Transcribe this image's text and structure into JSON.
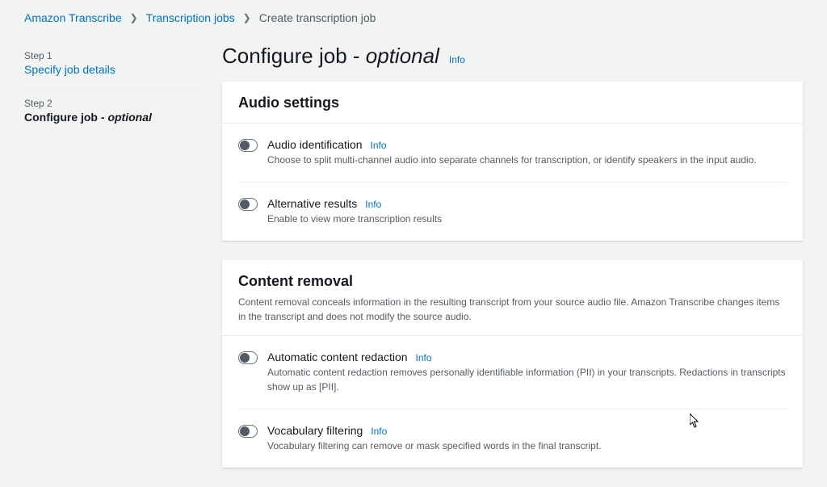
{
  "breadcrumb": {
    "item1": "Amazon Transcribe",
    "item2": "Transcription jobs",
    "current": "Create transcription job"
  },
  "sidebar": {
    "step1_label": "Step 1",
    "step1_link": "Specify job details",
    "step2_label": "Step 2",
    "step2_text_pre": "Configure job - ",
    "step2_text_em": "optional"
  },
  "page": {
    "title_pre": "Configure job ",
    "title_sep": "- ",
    "title_em": "optional",
    "info": "Info"
  },
  "audio": {
    "heading": "Audio settings",
    "item1_title": "Audio identification",
    "item1_info": "Info",
    "item1_desc": "Choose to split multi-channel audio into separate channels for transcription, or identify speakers in the input audio.",
    "item2_title": "Alternative results",
    "item2_info": "Info",
    "item2_desc": "Enable to view more transcription results"
  },
  "content": {
    "heading": "Content removal",
    "desc": "Content removal conceals information in the resulting transcript from your source audio file. Amazon Transcribe changes items in the transcript and does not modify the source audio.",
    "item1_title": "Automatic content redaction",
    "item1_info": "Info",
    "item1_desc": "Automatic content redaction removes personally identifiable information (PII) in your transcripts. Redactions in transcripts show up as [PII].",
    "item2_title": "Vocabulary filtering",
    "item2_info": "Info",
    "item2_desc": "Vocabulary filtering can remove or mask specified words in the final transcript."
  }
}
